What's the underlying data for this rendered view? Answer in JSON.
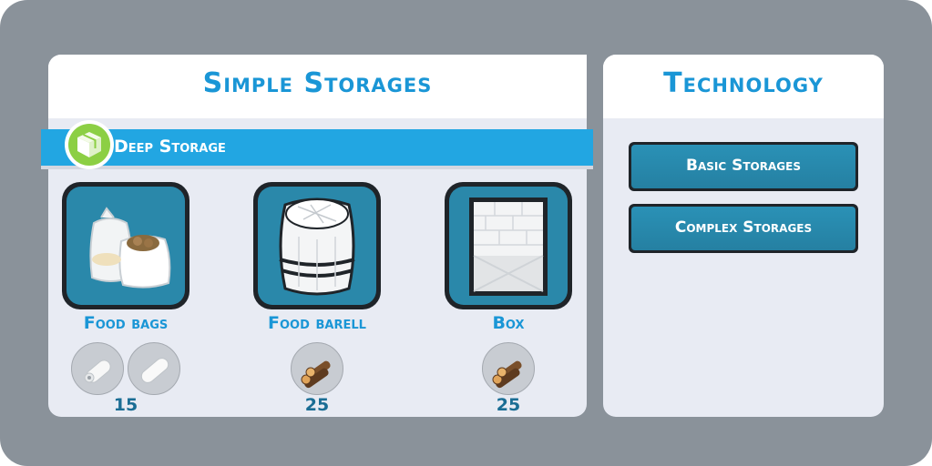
{
  "left_panel": {
    "title": "Simple Storages",
    "category": {
      "label": "Deep Storage",
      "icon": "crate-icon",
      "accent": "#8ccf44"
    },
    "items": [
      {
        "name": "Food bags",
        "image": "food-bags-icon",
        "cost_icons": [
          "paper-roll-icon",
          "cloth-roll-icon"
        ],
        "count": "15"
      },
      {
        "name": "Food barell",
        "image": "barrel-icon",
        "cost_icons": [
          "wood-logs-icon"
        ],
        "count": "25"
      },
      {
        "name": "Box",
        "image": "box-icon",
        "cost_icons": [
          "wood-logs-icon"
        ],
        "count": "25"
      }
    ]
  },
  "right_panel": {
    "title": "Technology",
    "buttons": [
      {
        "label": "Basic Storages"
      },
      {
        "label": "Complex Storages"
      }
    ]
  },
  "colors": {
    "background": "#8a929a",
    "title_blue": "#1a96d6",
    "ribbon_blue": "#22a6e2",
    "tile_blue": "#2a88aa",
    "button_blue": "#2580a2"
  }
}
